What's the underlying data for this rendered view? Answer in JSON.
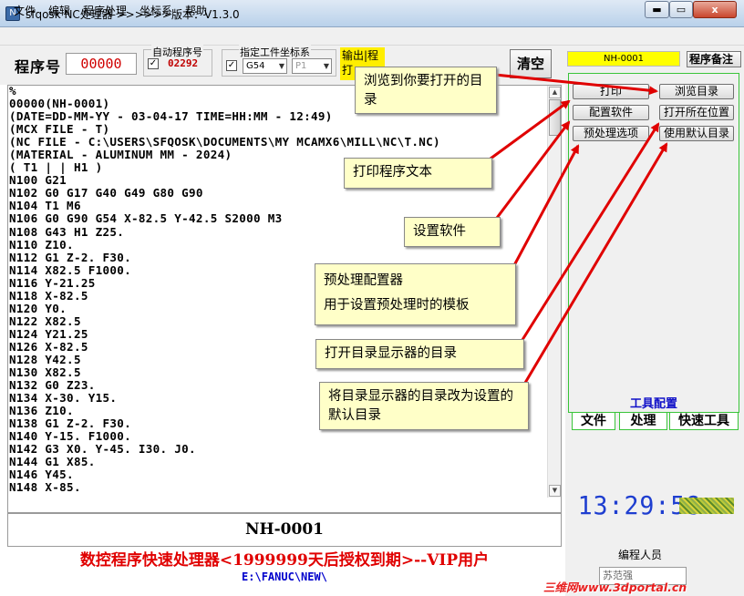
{
  "window": {
    "title": "sfqosk NC处理器 >>>>>>版本：V1.3.0",
    "controls": {
      "minimize": "▬",
      "maximize": "▭",
      "close": "x"
    }
  },
  "menu": {
    "items": [
      "文件",
      "编辑",
      "程序处理",
      "坐标系",
      "帮助"
    ]
  },
  "toolbar": {
    "program_label": "程序号",
    "program_number": "00000",
    "auto_program_title": "自动程序号",
    "auto_program_checked": "✓",
    "auto_program_value": "02292",
    "coord_title": "指定工件坐标系",
    "coord_checked": "✓",
    "coord_value": "G54",
    "coord_secondary": "P1",
    "output_label": "输出|程打",
    "clear_label": "清空"
  },
  "editor": {
    "lines": [
      "%",
      "00000(NH-0001)",
      "(DATE=DD-MM-YY - 03-04-17 TIME=HH:MM - 12:49)",
      "(MCX FILE - T)",
      "(NC FILE - C:\\USERS\\SFQOSK\\DOCUMENTS\\MY MCAMX6\\MILL\\NC\\T.NC)",
      "(MATERIAL - ALUMINUM MM - 2024)",
      "( T1 | | H1 )",
      "N100 G21",
      "N102 G0 G17 G40 G49 G80 G90",
      "N104 T1 M6",
      "N106 G0 G90 G54 X-82.5 Y-42.5 S2000 M3",
      "N108 G43 H1 Z25.",
      "N110 Z10.",
      "N112 G1 Z-2. F30.",
      "N114 X82.5 F1000.",
      "N116 Y-21.25",
      "N118 X-82.5",
      "N120 Y0.",
      "N122 X82.5",
      "N124 Y21.25",
      "N126 X-82.5",
      "N128 Y42.5",
      "N130 X82.5",
      "N132 G0 Z23.",
      "N134 X-30. Y15.",
      "N136 Z10.",
      "N138 G1 Z-2. F30.",
      "N140 Y-15. F1000.",
      "N142 G3 X0. Y-45. I30. J0.",
      "N144 G1 X85.",
      "N146 Y45.",
      "N148 X-85."
    ],
    "program_name": "NH-0001"
  },
  "status": {
    "banner": "数控程序快速处理器<1999999天后授权到期>--VIP用户",
    "path": "E:\\FANUC\\NEW\\"
  },
  "right_panel": {
    "program_id": "NH-0001",
    "note_button": "程序备注",
    "buttons": {
      "print": "打印",
      "browse": "浏览目录",
      "settings": "配置软件",
      "open_location": "打开所在位置",
      "preprocess": "预处理选项",
      "default_dir": "使用默认目录"
    },
    "tool_config_label": "工具配置",
    "tabs": [
      "文件",
      "处理",
      "快速工具"
    ],
    "clock": "13:29:58",
    "programmer_label": "编程人员",
    "programmer_value": "苏范强"
  },
  "annotations": {
    "browse": "浏览到你要打开的目录",
    "print": "打印程序文本",
    "settings": "设置软件",
    "preproc_title": "预处理配置器",
    "preproc_desc": "用于设置预处理时的模板",
    "open_location": "打开目录显示器的目录",
    "default_dir": "将目录显示器的目录改为设置的默认目录"
  },
  "watermark": "三维网www.3dportal.cn",
  "colors": {
    "program_number": "#d00000",
    "id_box": "#ffff00",
    "banner": "#e00000",
    "path": "#0000cc",
    "clock": "#1e3ed0",
    "arrow": "#e00000",
    "note_bg": "#ffffc8",
    "group_border": "#39c439"
  }
}
